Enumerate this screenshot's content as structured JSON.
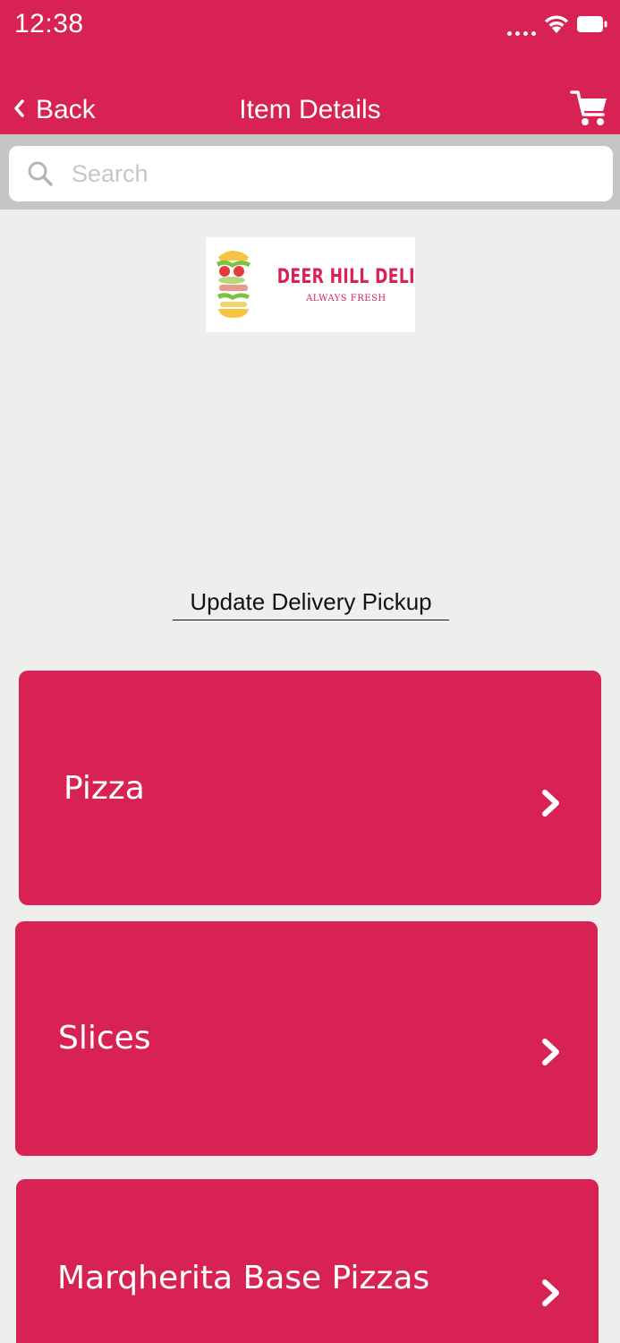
{
  "status_bar": {
    "time": "12:38"
  },
  "nav": {
    "back_label": "Back",
    "title": "Item Details"
  },
  "search": {
    "placeholder": "Search",
    "value": ""
  },
  "logo": {
    "name": "DEER HILL DELI",
    "tagline": "ALWAYS FRESH"
  },
  "update_link": "Update Delivery Pickup",
  "categories": [
    {
      "label": "Pizza"
    },
    {
      "label": "Slices"
    },
    {
      "label": "Marqherita Base Pizzas"
    }
  ],
  "colors": {
    "primary": "#d82253",
    "background": "#eeeeec",
    "searchbar": "#c5c5c5"
  },
  "icons": [
    "wifi-icon",
    "battery-icon",
    "back-chevron-icon",
    "cart-icon",
    "search-icon",
    "chevron-right-icon"
  ]
}
